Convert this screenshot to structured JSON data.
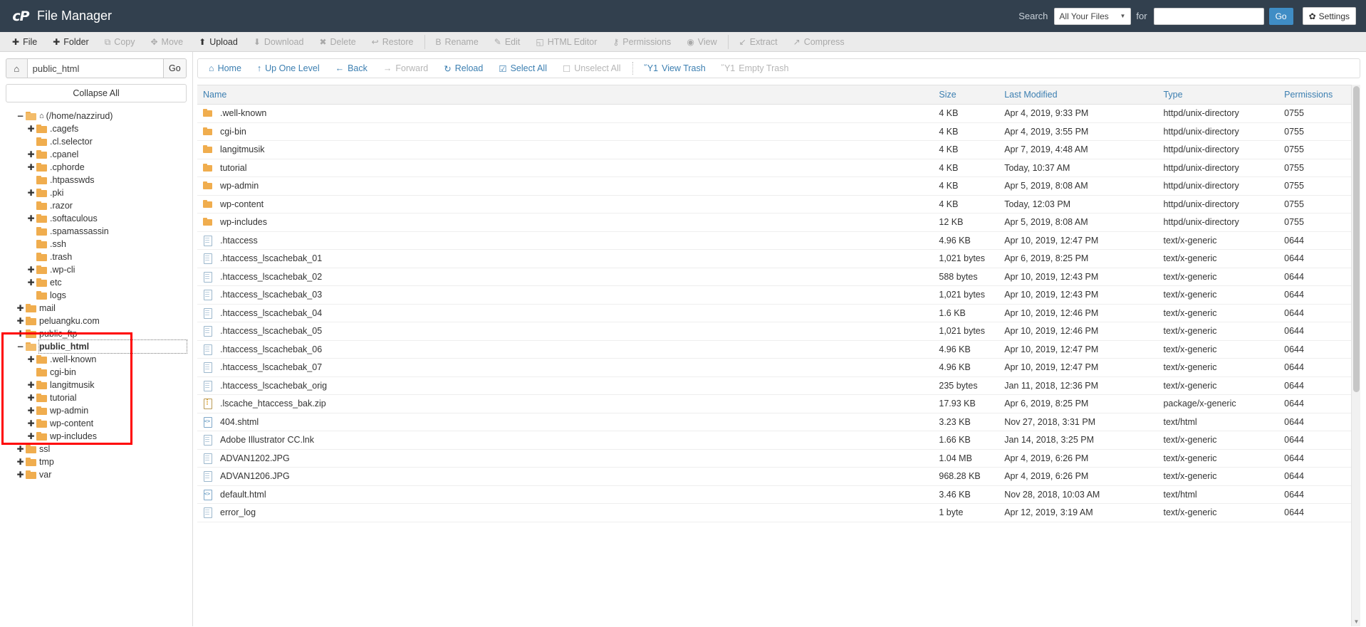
{
  "header": {
    "app_title": "File Manager",
    "logo_text": "cP",
    "search_label": "Search",
    "search_scope": "All Your Files",
    "for_label": "for",
    "search_value": "",
    "search_placeholder": "",
    "go_label": "Go",
    "settings_label": "Settings"
  },
  "toolbar": [
    {
      "label": "File",
      "icon": "plus-icon",
      "glyph": "✚",
      "disabled": false
    },
    {
      "label": "Folder",
      "icon": "plus-icon",
      "glyph": "✚",
      "disabled": false
    },
    {
      "label": "Copy",
      "icon": "copy-icon",
      "glyph": "⧉",
      "disabled": true
    },
    {
      "label": "Move",
      "icon": "move-icon",
      "glyph": "✥",
      "disabled": true
    },
    {
      "label": "Upload",
      "icon": "upload-icon",
      "glyph": "⬆",
      "disabled": false
    },
    {
      "label": "Download",
      "icon": "download-icon",
      "glyph": "⬇",
      "disabled": true
    },
    {
      "label": "Delete",
      "icon": "delete-icon",
      "glyph": "✖",
      "disabled": true
    },
    {
      "label": "Restore",
      "icon": "restore-icon",
      "glyph": "↩",
      "disabled": true
    },
    {
      "label": "SEP",
      "icon": "separator",
      "glyph": "",
      "disabled": true
    },
    {
      "label": "Rename",
      "icon": "rename-icon",
      "glyph": "὜B",
      "disabled": true
    },
    {
      "label": "Edit",
      "icon": "pencil-icon",
      "glyph": "✎",
      "disabled": true
    },
    {
      "label": "HTML Editor",
      "icon": "html-editor-icon",
      "glyph": "◱",
      "disabled": true
    },
    {
      "label": "Permissions",
      "icon": "key-icon",
      "glyph": "⚷",
      "disabled": true
    },
    {
      "label": "View",
      "icon": "eye-icon",
      "glyph": "◉",
      "disabled": true
    },
    {
      "label": "SEP",
      "icon": "separator",
      "glyph": "",
      "disabled": true
    },
    {
      "label": "Extract",
      "icon": "extract-icon",
      "glyph": "↙",
      "disabled": true
    },
    {
      "label": "Compress",
      "icon": "compress-icon",
      "glyph": "↗",
      "disabled": true
    }
  ],
  "sidebar": {
    "home_icon": "home-icon",
    "path_value": "public_html",
    "go_label": "Go",
    "collapse_all_label": "Collapse All",
    "tree": [
      {
        "label": "(/home/nazzirud)",
        "depth": 0,
        "toggle": "−",
        "open": true,
        "home": true,
        "bold": false,
        "highlight": false
      },
      {
        "label": ".cagefs",
        "depth": 1,
        "toggle": "✚",
        "open": false,
        "home": false,
        "bold": false,
        "highlight": false
      },
      {
        "label": ".cl.selector",
        "depth": 1,
        "toggle": "",
        "open": false,
        "home": false,
        "bold": false,
        "highlight": false
      },
      {
        "label": ".cpanel",
        "depth": 1,
        "toggle": "✚",
        "open": false,
        "home": false,
        "bold": false,
        "highlight": false
      },
      {
        "label": ".cphorde",
        "depth": 1,
        "toggle": "✚",
        "open": false,
        "home": false,
        "bold": false,
        "highlight": false
      },
      {
        "label": ".htpasswds",
        "depth": 1,
        "toggle": "",
        "open": false,
        "home": false,
        "bold": false,
        "highlight": false
      },
      {
        "label": ".pki",
        "depth": 1,
        "toggle": "✚",
        "open": false,
        "home": false,
        "bold": false,
        "highlight": false
      },
      {
        "label": ".razor",
        "depth": 1,
        "toggle": "",
        "open": false,
        "home": false,
        "bold": false,
        "highlight": false
      },
      {
        "label": ".softaculous",
        "depth": 1,
        "toggle": "✚",
        "open": false,
        "home": false,
        "bold": false,
        "highlight": false
      },
      {
        "label": ".spamassassin",
        "depth": 1,
        "toggle": "",
        "open": false,
        "home": false,
        "bold": false,
        "highlight": false
      },
      {
        "label": ".ssh",
        "depth": 1,
        "toggle": "",
        "open": false,
        "home": false,
        "bold": false,
        "highlight": false
      },
      {
        "label": ".trash",
        "depth": 1,
        "toggle": "",
        "open": false,
        "home": false,
        "bold": false,
        "highlight": false
      },
      {
        "label": ".wp-cli",
        "depth": 1,
        "toggle": "✚",
        "open": false,
        "home": false,
        "bold": false,
        "highlight": false
      },
      {
        "label": "etc",
        "depth": 1,
        "toggle": "✚",
        "open": false,
        "home": false,
        "bold": false,
        "highlight": false
      },
      {
        "label": "logs",
        "depth": 1,
        "toggle": "",
        "open": false,
        "home": false,
        "bold": false,
        "highlight": false
      },
      {
        "label": "mail",
        "depth": 0,
        "toggle": "✚",
        "open": false,
        "home": false,
        "bold": false,
        "highlight": false
      },
      {
        "label": "peluangku.com",
        "depth": 0,
        "toggle": "✚",
        "open": false,
        "home": false,
        "bold": false,
        "highlight": false
      },
      {
        "label": "public_ftp",
        "depth": 0,
        "toggle": "✚",
        "open": false,
        "home": false,
        "bold": false,
        "highlight": false
      },
      {
        "label": "public_html",
        "depth": 0,
        "toggle": "−",
        "open": true,
        "home": false,
        "bold": true,
        "highlight": true
      },
      {
        "label": ".well-known",
        "depth": 1,
        "toggle": "✚",
        "open": false,
        "home": false,
        "bold": false,
        "highlight": false
      },
      {
        "label": "cgi-bin",
        "depth": 1,
        "toggle": "",
        "open": false,
        "home": false,
        "bold": false,
        "highlight": false
      },
      {
        "label": "langitmusik",
        "depth": 1,
        "toggle": "✚",
        "open": false,
        "home": false,
        "bold": false,
        "highlight": false
      },
      {
        "label": "tutorial",
        "depth": 1,
        "toggle": "✚",
        "open": false,
        "home": false,
        "bold": false,
        "highlight": false
      },
      {
        "label": "wp-admin",
        "depth": 1,
        "toggle": "✚",
        "open": false,
        "home": false,
        "bold": false,
        "highlight": false
      },
      {
        "label": "wp-content",
        "depth": 1,
        "toggle": "✚",
        "open": false,
        "home": false,
        "bold": false,
        "highlight": false
      },
      {
        "label": "wp-includes",
        "depth": 1,
        "toggle": "✚",
        "open": false,
        "home": false,
        "bold": false,
        "highlight": false
      },
      {
        "label": "ssl",
        "depth": 0,
        "toggle": "✚",
        "open": false,
        "home": false,
        "bold": false,
        "highlight": false
      },
      {
        "label": "tmp",
        "depth": 0,
        "toggle": "✚",
        "open": false,
        "home": false,
        "bold": false,
        "highlight": false
      },
      {
        "label": "var",
        "depth": 0,
        "toggle": "✚",
        "open": false,
        "home": false,
        "bold": false,
        "highlight": false
      }
    ],
    "annotation": {
      "color": "#ff0000",
      "shape": "rectangle"
    }
  },
  "navbar": [
    {
      "label": "Home",
      "icon": "home-icon",
      "glyph": "⌂",
      "disabled": false
    },
    {
      "label": "Up One Level",
      "icon": "arrow-up-icon",
      "glyph": "↑",
      "disabled": false
    },
    {
      "label": "Back",
      "icon": "arrow-left-icon",
      "glyph": "←",
      "disabled": false
    },
    {
      "label": "Forward",
      "icon": "arrow-right-icon",
      "glyph": "→",
      "disabled": true
    },
    {
      "label": "Reload",
      "icon": "reload-icon",
      "glyph": "↻",
      "disabled": false
    },
    {
      "label": "Select All",
      "icon": "checkbox-checked-icon",
      "glyph": "☑",
      "disabled": false
    },
    {
      "label": "Unselect All",
      "icon": "checkbox-empty-icon",
      "glyph": "☐",
      "disabled": true
    },
    {
      "label": "SEP",
      "icon": "separator",
      "glyph": "",
      "disabled": true
    },
    {
      "label": "View Trash",
      "icon": "trash-icon",
      "glyph": "Ὕ1",
      "disabled": false
    },
    {
      "label": "Empty Trash",
      "icon": "trash-icon",
      "glyph": "Ὕ1",
      "disabled": true
    }
  ],
  "table": {
    "columns": [
      "Name",
      "Size",
      "Last Modified",
      "Type",
      "Permissions"
    ],
    "rows": [
      {
        "icon": "folder-icon",
        "kind": "folder",
        "name": ".well-known",
        "size": "4 KB",
        "modified": "Apr 4, 2019, 9:33 PM",
        "type": "httpd/unix-directory",
        "perm": "0755"
      },
      {
        "icon": "folder-icon",
        "kind": "folder",
        "name": "cgi-bin",
        "size": "4 KB",
        "modified": "Apr 4, 2019, 3:55 PM",
        "type": "httpd/unix-directory",
        "perm": "0755"
      },
      {
        "icon": "folder-icon",
        "kind": "folder",
        "name": "langitmusik",
        "size": "4 KB",
        "modified": "Apr 7, 2019, 4:48 AM",
        "type": "httpd/unix-directory",
        "perm": "0755"
      },
      {
        "icon": "folder-icon",
        "kind": "folder",
        "name": "tutorial",
        "size": "4 KB",
        "modified": "Today, 10:37 AM",
        "type": "httpd/unix-directory",
        "perm": "0755"
      },
      {
        "icon": "folder-icon",
        "kind": "folder",
        "name": "wp-admin",
        "size": "4 KB",
        "modified": "Apr 5, 2019, 8:08 AM",
        "type": "httpd/unix-directory",
        "perm": "0755"
      },
      {
        "icon": "folder-icon",
        "kind": "folder",
        "name": "wp-content",
        "size": "4 KB",
        "modified": "Today, 12:03 PM",
        "type": "httpd/unix-directory",
        "perm": "0755"
      },
      {
        "icon": "folder-icon",
        "kind": "folder",
        "name": "wp-includes",
        "size": "12 KB",
        "modified": "Apr 5, 2019, 8:08 AM",
        "type": "httpd/unix-directory",
        "perm": "0755"
      },
      {
        "icon": "file-icon",
        "kind": "file",
        "name": ".htaccess",
        "size": "4.96 KB",
        "modified": "Apr 10, 2019, 12:47 PM",
        "type": "text/x-generic",
        "perm": "0644"
      },
      {
        "icon": "file-icon",
        "kind": "file",
        "name": ".htaccess_lscachebak_01",
        "size": "1,021 bytes",
        "modified": "Apr 6, 2019, 8:25 PM",
        "type": "text/x-generic",
        "perm": "0644"
      },
      {
        "icon": "file-icon",
        "kind": "file",
        "name": ".htaccess_lscachebak_02",
        "size": "588 bytes",
        "modified": "Apr 10, 2019, 12:43 PM",
        "type": "text/x-generic",
        "perm": "0644"
      },
      {
        "icon": "file-icon",
        "kind": "file",
        "name": ".htaccess_lscachebak_03",
        "size": "1,021 bytes",
        "modified": "Apr 10, 2019, 12:43 PM",
        "type": "text/x-generic",
        "perm": "0644"
      },
      {
        "icon": "file-icon",
        "kind": "file",
        "name": ".htaccess_lscachebak_04",
        "size": "1.6 KB",
        "modified": "Apr 10, 2019, 12:46 PM",
        "type": "text/x-generic",
        "perm": "0644"
      },
      {
        "icon": "file-icon",
        "kind": "file",
        "name": ".htaccess_lscachebak_05",
        "size": "1,021 bytes",
        "modified": "Apr 10, 2019, 12:46 PM",
        "type": "text/x-generic",
        "perm": "0644"
      },
      {
        "icon": "file-icon",
        "kind": "file",
        "name": ".htaccess_lscachebak_06",
        "size": "4.96 KB",
        "modified": "Apr 10, 2019, 12:47 PM",
        "type": "text/x-generic",
        "perm": "0644"
      },
      {
        "icon": "file-icon",
        "kind": "file",
        "name": ".htaccess_lscachebak_07",
        "size": "4.96 KB",
        "modified": "Apr 10, 2019, 12:47 PM",
        "type": "text/x-generic",
        "perm": "0644"
      },
      {
        "icon": "file-icon",
        "kind": "file",
        "name": ".htaccess_lscachebak_orig",
        "size": "235 bytes",
        "modified": "Jan 11, 2018, 12:36 PM",
        "type": "text/x-generic",
        "perm": "0644"
      },
      {
        "icon": "zip-icon",
        "kind": "zip",
        "name": ".lscache_htaccess_bak.zip",
        "size": "17.93 KB",
        "modified": "Apr 6, 2019, 8:25 PM",
        "type": "package/x-generic",
        "perm": "0644"
      },
      {
        "icon": "code-icon",
        "kind": "code",
        "name": "404.shtml",
        "size": "3.23 KB",
        "modified": "Nov 27, 2018, 3:31 PM",
        "type": "text/html",
        "perm": "0644"
      },
      {
        "icon": "file-icon",
        "kind": "file",
        "name": "Adobe Illustrator CC.lnk",
        "size": "1.66 KB",
        "modified": "Jan 14, 2018, 3:25 PM",
        "type": "text/x-generic",
        "perm": "0644"
      },
      {
        "icon": "file-icon",
        "kind": "file",
        "name": "ADVAN1202.JPG",
        "size": "1.04 MB",
        "modified": "Apr 4, 2019, 6:26 PM",
        "type": "text/x-generic",
        "perm": "0644"
      },
      {
        "icon": "file-icon",
        "kind": "file",
        "name": "ADVAN1206.JPG",
        "size": "968.28 KB",
        "modified": "Apr 4, 2019, 6:26 PM",
        "type": "text/x-generic",
        "perm": "0644"
      },
      {
        "icon": "code-icon",
        "kind": "code",
        "name": "default.html",
        "size": "3.46 KB",
        "modified": "Nov 28, 2018, 10:03 AM",
        "type": "text/html",
        "perm": "0644"
      },
      {
        "icon": "file-icon",
        "kind": "file",
        "name": "error_log",
        "size": "1 byte",
        "modified": "Apr 12, 2019, 3:19 AM",
        "type": "text/x-generic",
        "perm": "0644"
      }
    ]
  }
}
